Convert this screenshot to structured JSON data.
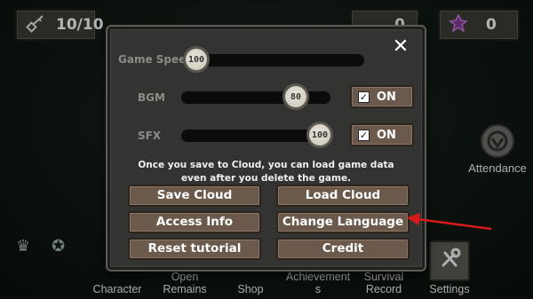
{
  "hud": {
    "energy": "10/10",
    "gold": "0",
    "gem": "0"
  },
  "side": {
    "attendance_label": "Attendance"
  },
  "bottom_nav": {
    "items": [
      "Character",
      "Open\nRemains",
      "Shop",
      "Achievement\ns",
      "Survival\nRecord",
      "Settings"
    ]
  },
  "dialog": {
    "game_speed_label": "Game Speed",
    "game_speed_value": "100",
    "bgm_label": "BGM",
    "bgm_value": "80",
    "bgm_toggle": "ON",
    "sfx_label": "SFX",
    "sfx_value": "100",
    "sfx_toggle": "ON",
    "notice": "Once you save to Cloud, you can load game data even after you delete the game.",
    "buttons": {
      "save_cloud": "Save Cloud",
      "load_cloud": "Load Cloud",
      "access_info": "Access Info",
      "change_language": "Change Language",
      "reset_tutorial": "Reset tutorial",
      "credit": "Credit"
    }
  },
  "colors": {
    "dialog_bg": "#333331",
    "button_bg": "#6b5a4c",
    "annotation_arrow": "#d81a1a"
  }
}
